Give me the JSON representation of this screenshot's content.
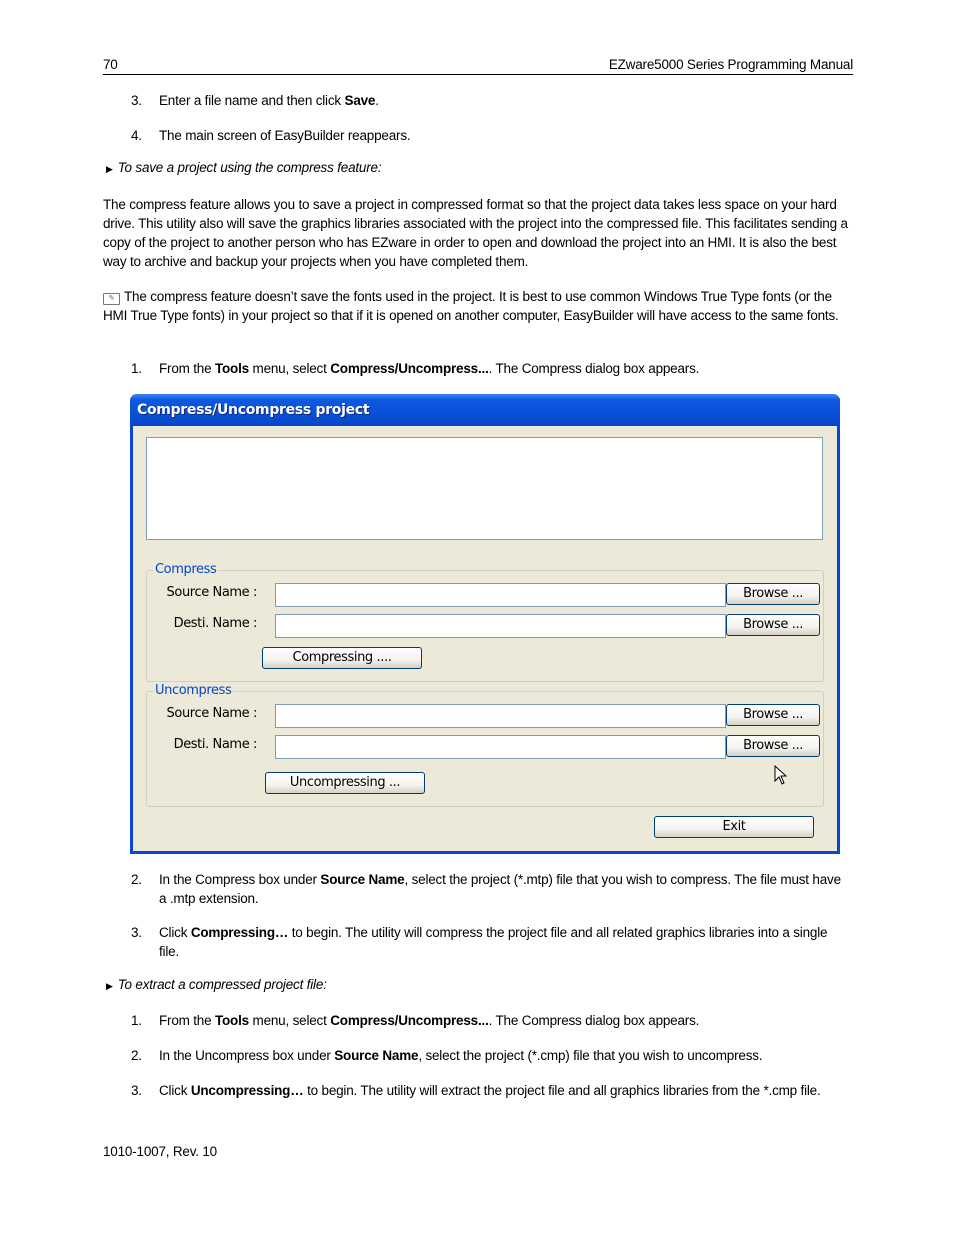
{
  "header": {
    "page_number": "70",
    "manual_title": "EZware5000 Series Programming Manual"
  },
  "steps_top": [
    {
      "num": "3.",
      "pre": "Enter a file name and then click ",
      "bold": "Save",
      "post": "."
    },
    {
      "num": "4.",
      "text": "The main screen of EasyBuilder reappears."
    }
  ],
  "section_compress": {
    "heading": "To save a project using the compress feature:",
    "paragraph": "The compress feature allows you to save a project in compressed format so that the project data takes less space on your hard drive. This utility also will save the graphics libraries associated with the project into the compressed file. This facilitates sending a copy of the project to another person who has EZware in order to open and download the project into an HMI. It is also the best way to archive and backup your projects when you have completed them.",
    "note_icon": "note-pencil-icon",
    "note": "The compress feature doesn’t save the fonts used in the project. It is best to use common Windows True Type fonts (or the HMI True Type fonts) in your project so that if it is opened on another computer, EasyBuilder will have access to the same fonts.",
    "step1": {
      "num": "1.",
      "pre": "From the ",
      "b1": "Tools",
      "mid": " menu, select ",
      "b2": "Compress/Uncompress...",
      "post": ". The Compress dialog box appears."
    }
  },
  "dialog": {
    "title": "Compress/Uncompress project",
    "compress": {
      "legend": "Compress",
      "source_label": "Source Name :",
      "source_value": "",
      "dest_label": "Desti. Name :",
      "dest_value": "",
      "browse_label": "Browse ...",
      "action_label": "Compressing ...."
    },
    "uncompress": {
      "legend": "Uncompress",
      "source_label": "Source Name :",
      "source_value": "",
      "dest_label": "Desti. Name :",
      "dest_value": "",
      "browse_label": "Browse ...",
      "action_label": "Uncompressing ..."
    },
    "exit_label": "Exit"
  },
  "steps_after_dialog": [
    {
      "num": "2.",
      "pre": "In the Compress box under ",
      "bold": "Source Name",
      "post": ", select the project (*.mtp) file that you wish to compress. The file must have a .mtp extension."
    },
    {
      "num": "3.",
      "pre": "Click ",
      "bold": "Compressing…",
      "post": " to begin. The utility will compress the project file and all related graphics libraries into a single file."
    }
  ],
  "section_extract": {
    "heading": "To extract a compressed project file:",
    "steps": [
      {
        "num": "1.",
        "pre": "From the ",
        "b1": "Tools",
        "mid": " menu, select ",
        "b2": "Compress/Uncompress...",
        "post": ". The Compress dialog box appears."
      },
      {
        "num": "2.",
        "pre": "In the Uncompress box under ",
        "bold": "Source Name",
        "post": ", select the project (*.cmp) file that you wish to uncompress."
      },
      {
        "num": "3.",
        "pre": "Click ",
        "bold": "Uncompressing…",
        "post": " to begin. The utility will extract the project file and all graphics libraries from the *.cmp file."
      }
    ]
  },
  "footer": {
    "doc_id": "1010-1007, Rev. 10"
  }
}
